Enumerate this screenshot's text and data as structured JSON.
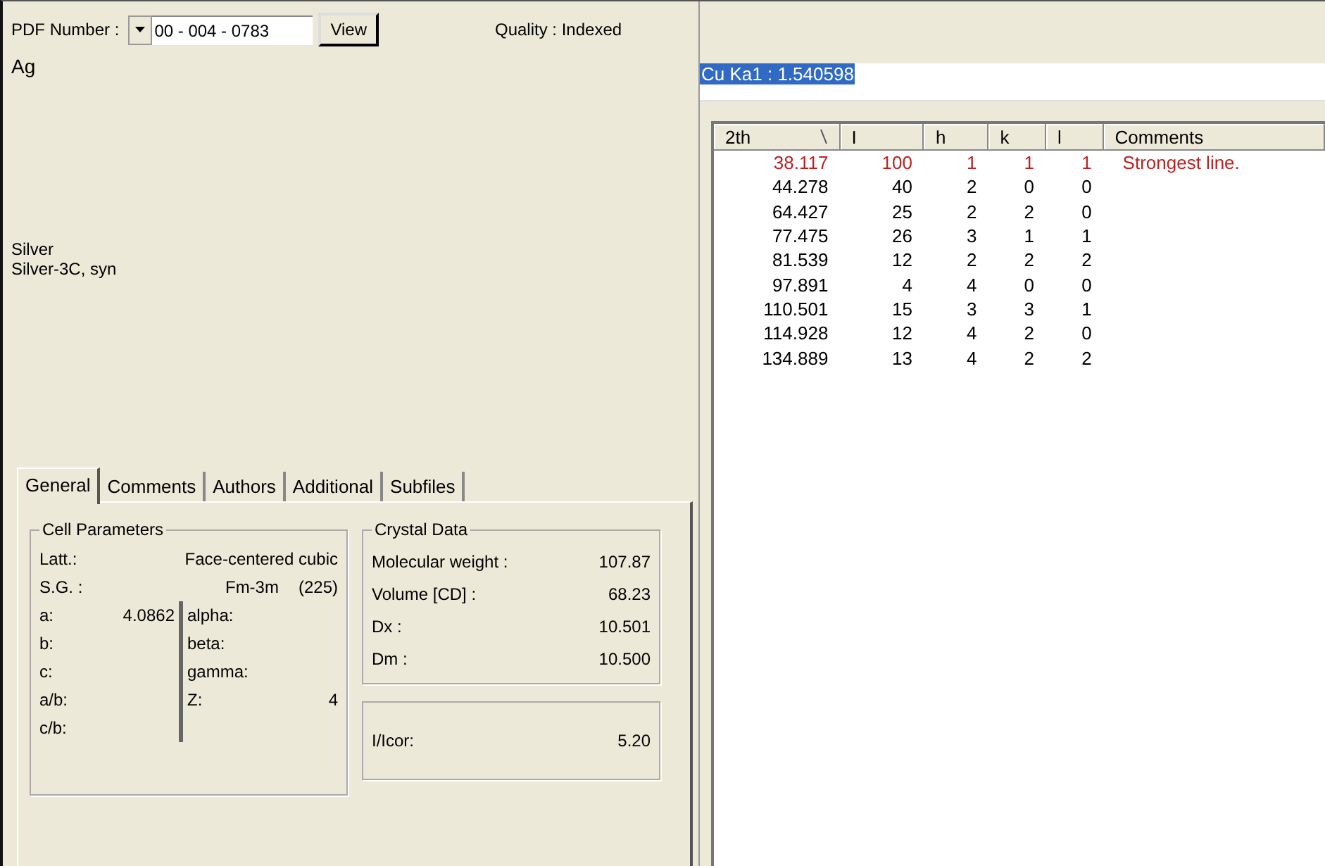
{
  "toolbar": {
    "pdf_label": "PDF Number :",
    "pdf_number": "00 - 004 - 0783",
    "view_button": "View",
    "quality": "Quality : Indexed"
  },
  "formula": "Ag",
  "names": [
    "Silver",
    "Silver-3C, syn"
  ],
  "tabs": [
    {
      "label": "General",
      "selected": true
    },
    {
      "label": "Comments",
      "selected": false
    },
    {
      "label": "Authors",
      "selected": false
    },
    {
      "label": "Additional",
      "selected": false
    },
    {
      "label": "Subfiles",
      "selected": false
    }
  ],
  "cell_parameters": {
    "title": "Cell Parameters",
    "lattice": {
      "label": "Latt.:",
      "value": "Face-centered cubic"
    },
    "space_group": {
      "label": "S.G. :",
      "symbol": "Fm-3m",
      "number": "(225)"
    },
    "lengths": [
      {
        "label": "a:",
        "value": "4.0862"
      },
      {
        "label": "b:"
      },
      {
        "label": "c:"
      },
      {
        "label": "a/b:"
      },
      {
        "label": "c/b:"
      }
    ],
    "angles": [
      {
        "label": "alpha:"
      },
      {
        "label": "beta:"
      },
      {
        "label": "gamma:"
      },
      {
        "label": "Z:",
        "value": "4"
      }
    ]
  },
  "crystal_data": {
    "title": "Crystal Data",
    "rows": [
      {
        "label": "Molecular weight :",
        "value": "107.87"
      },
      {
        "label": "Volume [CD] :",
        "value": "68.23"
      },
      {
        "label": "Dx :",
        "value": "10.501"
      },
      {
        "label": "Dm :",
        "value": "10.500"
      }
    ]
  },
  "icor": {
    "label": "I/Icor:",
    "value": "5.20"
  },
  "wavelength": {
    "value": "Cu Ka1 : 1.540598",
    "selected": true
  },
  "table": {
    "columns": [
      "2th",
      "I",
      "h",
      "k",
      "l",
      "Comments"
    ],
    "rows": [
      {
        "cells": [
          "38.117",
          "100",
          "1",
          "1",
          "1"
        ],
        "comment": "Strongest line.",
        "strongest": true
      },
      {
        "cells": [
          "44.278",
          "40",
          "2",
          "0",
          "0"
        ],
        "strongest": false
      },
      {
        "cells": [
          "64.427",
          "25",
          "2",
          "2",
          "0"
        ],
        "strongest": false
      },
      {
        "cells": [
          "77.475",
          "26",
          "3",
          "1",
          "1"
        ],
        "strongest": false
      },
      {
        "cells": [
          "81.539",
          "12",
          "2",
          "2",
          "2"
        ],
        "strongest": false
      },
      {
        "cells": [
          "97.891",
          "4",
          "4",
          "0",
          "0"
        ],
        "strongest": false
      },
      {
        "cells": [
          "110.501",
          "15",
          "3",
          "3",
          "1"
        ],
        "strongest": false
      },
      {
        "cells": [
          "114.928",
          "12",
          "4",
          "2",
          "0"
        ],
        "strongest": false
      },
      {
        "cells": [
          "134.889",
          "13",
          "4",
          "2",
          "2"
        ],
        "strongest": false
      }
    ]
  }
}
